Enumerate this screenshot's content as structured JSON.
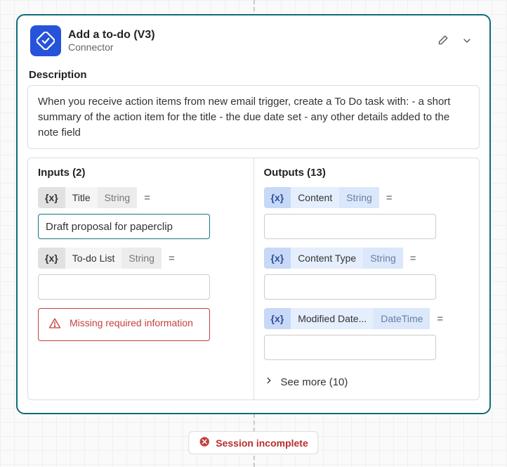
{
  "header": {
    "title": "Add a to-do (V3)",
    "subtitle": "Connector"
  },
  "description_label": "Description",
  "description_text": "When you receive action items from new email trigger, create a To Do task with: - a short summary of the action item for the title - the due date set - any other details added to the note field",
  "inputs": {
    "title": "Inputs (2)",
    "items": [
      {
        "token": "{x}",
        "name": "Title",
        "type": "String",
        "eq": "=",
        "value": "Draft proposal for paperclip",
        "active": true
      },
      {
        "token": "{x}",
        "name": "To-do List",
        "type": "String",
        "eq": "=",
        "value": "",
        "active": false
      }
    ],
    "error": "Missing required information"
  },
  "outputs": {
    "title": "Outputs (13)",
    "items": [
      {
        "token": "{x}",
        "name": "Content",
        "type": "String",
        "eq": "=",
        "value": ""
      },
      {
        "token": "{x}",
        "name": "Content Type",
        "type": "String",
        "eq": "=",
        "value": ""
      },
      {
        "token": "{x}",
        "name": "Modified Date...",
        "type": "DateTime",
        "eq": "=",
        "value": ""
      }
    ],
    "see_more": "See more (10)"
  },
  "footer": {
    "status": "Session incomplete"
  }
}
